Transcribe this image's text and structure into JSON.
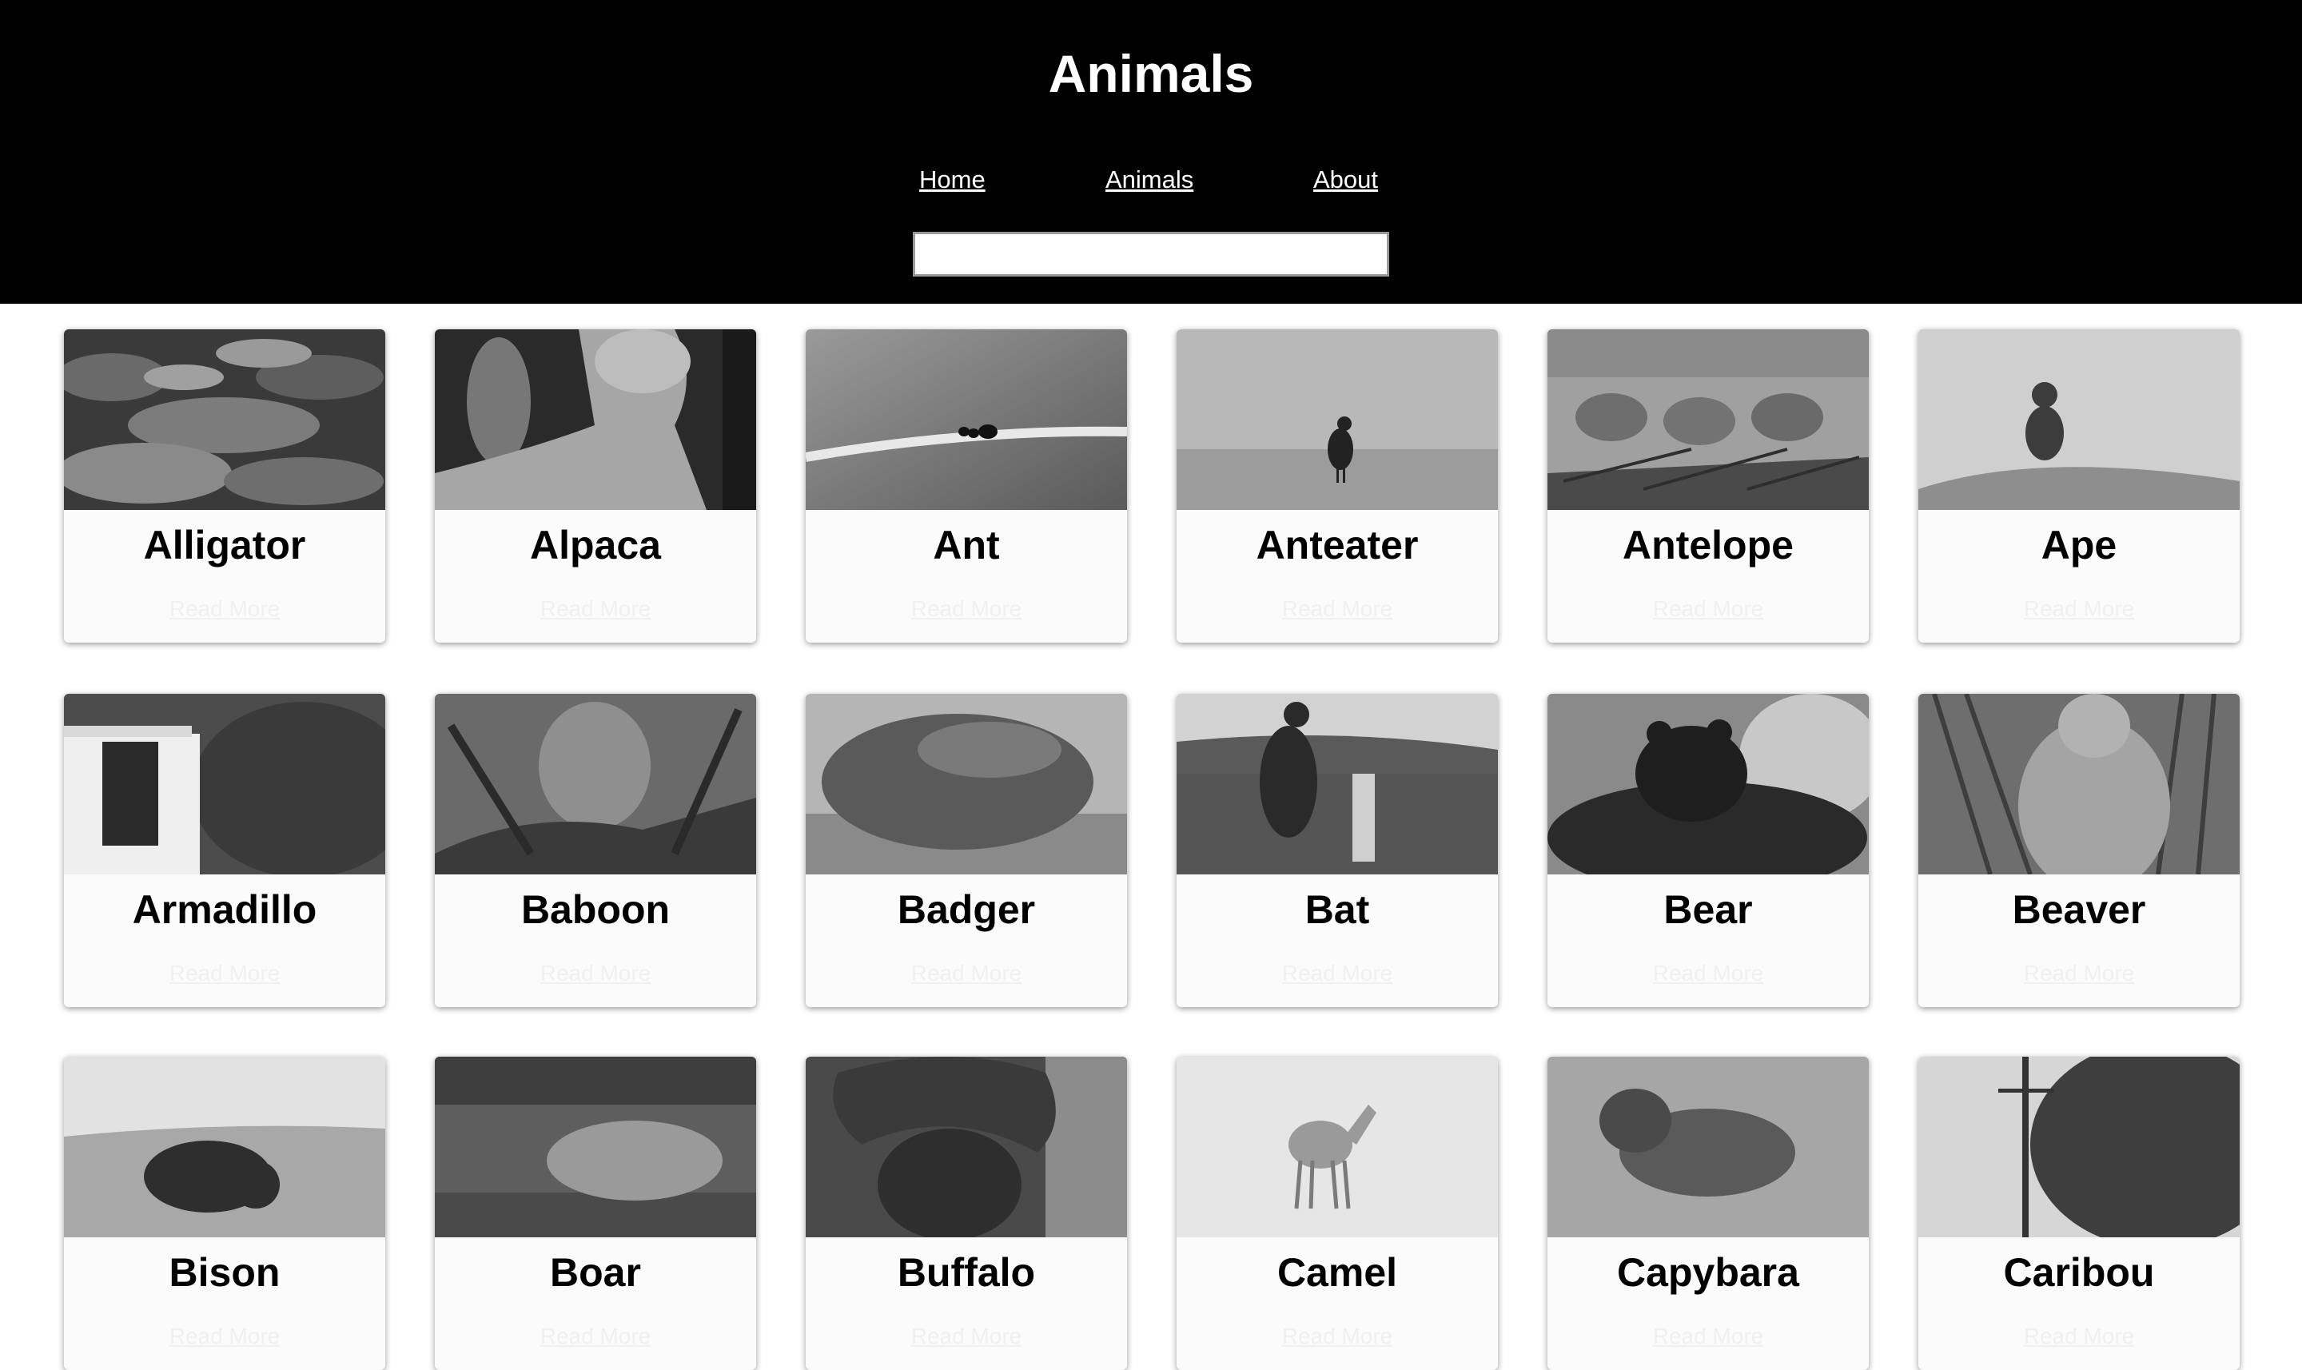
{
  "header": {
    "title": "Animals",
    "nav": {
      "home": "Home",
      "animals": "Animals",
      "about": "About"
    },
    "search": {
      "value": "",
      "placeholder": ""
    }
  },
  "cards": [
    {
      "name": "Alligator",
      "link": "Read More"
    },
    {
      "name": "Alpaca",
      "link": "Read More"
    },
    {
      "name": "Ant",
      "link": "Read More"
    },
    {
      "name": "Anteater",
      "link": "Read More"
    },
    {
      "name": "Antelope",
      "link": "Read More"
    },
    {
      "name": "Ape",
      "link": "Read More"
    },
    {
      "name": "Armadillo",
      "link": "Read More"
    },
    {
      "name": "Baboon",
      "link": "Read More"
    },
    {
      "name": "Badger",
      "link": "Read More"
    },
    {
      "name": "Bat",
      "link": "Read More"
    },
    {
      "name": "Bear",
      "link": "Read More"
    },
    {
      "name": "Beaver",
      "link": "Read More"
    },
    {
      "name": "Bison",
      "link": "Read More"
    },
    {
      "name": "Boar",
      "link": "Read More"
    },
    {
      "name": "Buffalo",
      "link": "Read More"
    },
    {
      "name": "Camel",
      "link": "Read More"
    },
    {
      "name": "Capybara",
      "link": "Read More"
    },
    {
      "name": "Caribou",
      "link": "Read More"
    }
  ]
}
